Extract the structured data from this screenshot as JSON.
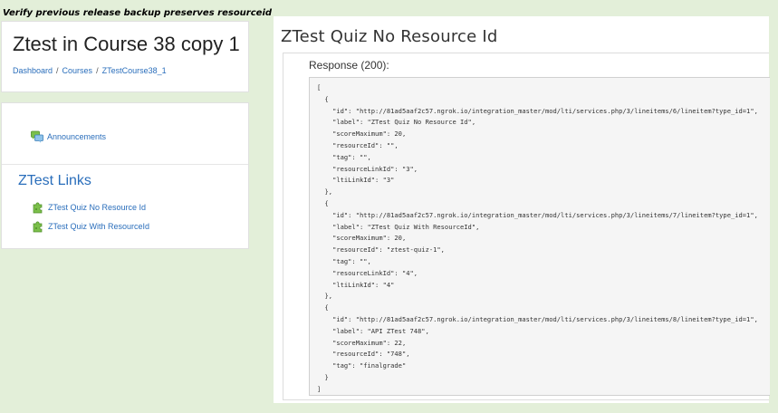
{
  "caption": "Verify previous release backup preserves resourceid",
  "course": {
    "title": "Ztest in Course 38 copy 1",
    "breadcrumb": [
      {
        "label": "Dashboard"
      },
      {
        "label": "Courses"
      },
      {
        "label": "ZTestCourse38_1"
      }
    ],
    "separator": "/"
  },
  "activities": {
    "announcements_label": "Announcements",
    "section_title": "ZTest Links",
    "links": [
      {
        "label": "ZTest Quiz No Resource Id",
        "icon": "puzzle-icon"
      },
      {
        "label": "ZTest Quiz With ResourceId",
        "icon": "puzzle-icon"
      }
    ],
    "announcements_icon": "forum-icon"
  },
  "panel": {
    "title": "ZTest Quiz No Resource Id",
    "response_label": "Response (200):",
    "response_body": "[\n  {\n    \"id\": \"http://81ad5aaf2c57.ngrok.io/integration_master/mod/lti/services.php/3/lineitems/6/lineitem?type_id=1\",\n    \"label\": \"ZTest Quiz No Resource Id\",\n    \"scoreMaximum\": 20,\n    \"resourceId\": \"\",\n    \"tag\": \"\",\n    \"resourceLinkId\": \"3\",\n    \"ltiLinkId\": \"3\"\n  },\n  {\n    \"id\": \"http://81ad5aaf2c57.ngrok.io/integration_master/mod/lti/services.php/3/lineitems/7/lineitem?type_id=1\",\n    \"label\": \"ZTest Quiz With ResourceId\",\n    \"scoreMaximum\": 20,\n    \"resourceId\": \"ztest-quiz-1\",\n    \"tag\": \"\",\n    \"resourceLinkId\": \"4\",\n    \"ltiLinkId\": \"4\"\n  },\n  {\n    \"id\": \"http://81ad5aaf2c57.ngrok.io/integration_master/mod/lti/services.php/3/lineitems/8/lineitem?type_id=1\",\n    \"label\": \"API ZTest 748\",\n    \"scoreMaximum\": 22,\n    \"resourceId\": \"748\",\n    \"tag\": \"finalgrade\"\n  }\n]"
  },
  "colors": {
    "background": "#e3efd9",
    "link": "#2a6ebb",
    "code_bg": "#f5f5f5"
  }
}
